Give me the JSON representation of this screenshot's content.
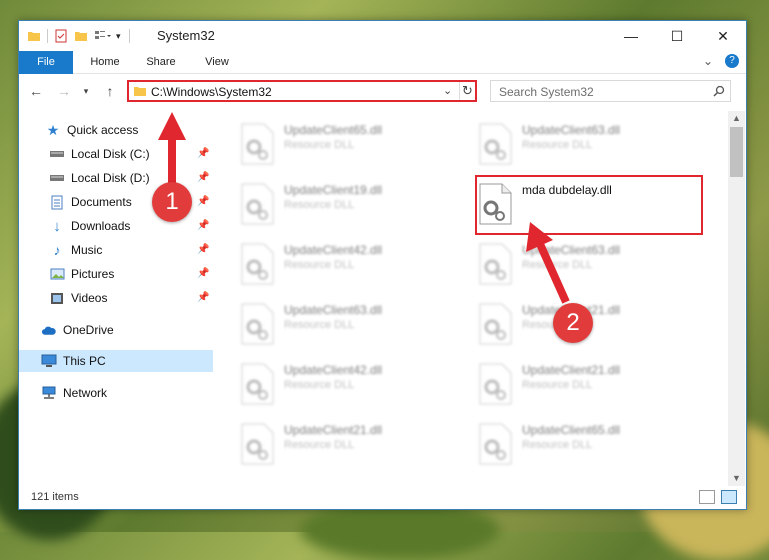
{
  "window": {
    "title": "System32"
  },
  "ribbon": {
    "tabs": [
      "File",
      "Home",
      "Share",
      "View"
    ]
  },
  "address": {
    "path": "C:\\Windows\\System32"
  },
  "search": {
    "placeholder": "Search System32"
  },
  "sidebar": {
    "items": [
      {
        "label": "Quick access",
        "icon": "star-icon"
      },
      {
        "label": "Local Disk (C:)",
        "icon": "drive-icon",
        "pinned": true
      },
      {
        "label": "Local Disk (D:)",
        "icon": "drive-icon",
        "pinned": true
      },
      {
        "label": "Documents",
        "icon": "documents-icon",
        "pinned": true
      },
      {
        "label": "Downloads",
        "icon": "download-icon",
        "pinned": true
      },
      {
        "label": "Music",
        "icon": "music-icon",
        "pinned": true
      },
      {
        "label": "Pictures",
        "icon": "pictures-icon",
        "pinned": true
      },
      {
        "label": "Videos",
        "icon": "videos-icon",
        "pinned": true
      },
      {
        "label": "OneDrive",
        "icon": "cloud-icon"
      },
      {
        "label": "This PC",
        "icon": "computer-icon",
        "selected": true
      },
      {
        "label": "Network",
        "icon": "network-icon"
      }
    ]
  },
  "files": {
    "left": [
      {
        "name": "UpdateClient65.dll",
        "type": "Resource DLL"
      },
      {
        "name": "UpdateClient19.dll",
        "type": "Resource DLL"
      },
      {
        "name": "UpdateClient42.dll",
        "type": "Resource DLL"
      },
      {
        "name": "UpdateClient63.dll",
        "type": "Resource DLL"
      },
      {
        "name": "UpdateClient42.dll",
        "type": "Resource DLL"
      },
      {
        "name": "UpdateClient21.dll",
        "type": "Resource DLL"
      }
    ],
    "right": [
      {
        "name": "UpdateClient63.dll",
        "type": "Resource DLL"
      },
      {
        "name": "mda dubdelay.dll",
        "type": ""
      },
      {
        "name": "UpdateClient63.dll",
        "type": "Resource DLL"
      },
      {
        "name": "UpdateClient21.dll",
        "type": "Resource DLL"
      },
      {
        "name": "UpdateClient21.dll",
        "type": "Resource DLL"
      },
      {
        "name": "UpdateClient65.dll",
        "type": "Resource DLL"
      }
    ]
  },
  "status": {
    "item_count": "121 items"
  },
  "annotations": {
    "marker1": "1",
    "marker2": "2",
    "color": "#e0262e"
  }
}
